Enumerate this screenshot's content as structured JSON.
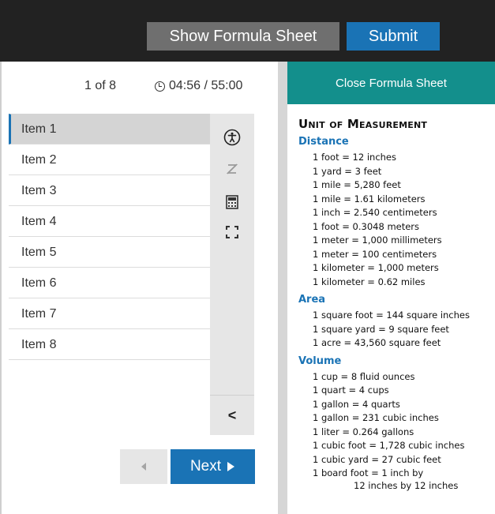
{
  "header": {
    "formula_button": "Show Formula Sheet",
    "submit_button": "Submit"
  },
  "status": {
    "counter": "1 of 8",
    "timer": "04:56 / 55:00"
  },
  "items": [
    {
      "label": "Item 1",
      "active": true
    },
    {
      "label": "Item 2"
    },
    {
      "label": "Item 3"
    },
    {
      "label": "Item 4"
    },
    {
      "label": "Item 5"
    },
    {
      "label": "Item 6"
    },
    {
      "label": "Item 7"
    },
    {
      "label": "Item 8"
    }
  ],
  "tools": [
    "accessibility-icon",
    "eliminator-icon",
    "calculator-icon",
    "fullscreen-icon"
  ],
  "nav": {
    "collapse_glyph": "<",
    "next_label": "Next"
  },
  "formula_sheet": {
    "close_label": "Close Formula Sheet",
    "title": "Unit of Measurement",
    "sections": [
      {
        "heading": "Distance",
        "lines": [
          "1 foot = 12 inches",
          "1 yard = 3 feet",
          "1 mile = 5,280 feet",
          "1 mile = 1.61 kilometers",
          "1 inch = 2.540 centimeters",
          "1 foot = 0.3048 meters",
          "1 meter = 1,000 millimeters",
          "1 meter = 100 centimeters",
          "1 kilometer = 1,000 meters",
          "1 kilometer = 0.62 miles"
        ]
      },
      {
        "heading": "Area",
        "lines": [
          "1 square foot = 144 square inches",
          "1 square yard = 9 square feet",
          "1 acre = 43,560 square feet"
        ]
      },
      {
        "heading": "Volume",
        "lines": [
          "1 cup = 8 fluid ounces",
          "1 quart = 4 cups",
          "1 gallon = 4 quarts",
          "1 gallon = 231 cubic inches",
          "1 liter = 0.264 gallons",
          "1 cubic foot = 1,728 cubic inches",
          "1 cubic yard = 27 cubic feet",
          "1 board foot = 1 inch by",
          "12 inches by 12 inches"
        ]
      }
    ]
  },
  "colors": {
    "accent": "#1a73b5",
    "teal": "#138f8c",
    "topbar": "#222222"
  }
}
